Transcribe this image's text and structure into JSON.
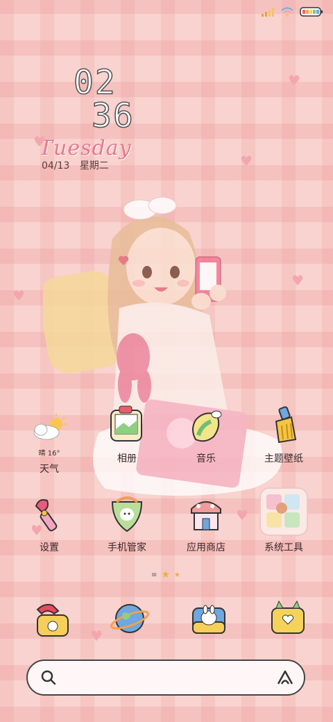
{
  "status": {
    "signal_icon": "signal-icon",
    "wifi_icon": "wifi-icon",
    "battery_icon": "battery-icon"
  },
  "clock": {
    "hours": "02",
    "minutes": "36",
    "day": "Tuesday",
    "date": "04/13",
    "weekday": "星期二"
  },
  "weather": {
    "temp": "晴 16°"
  },
  "apps_row1": [
    {
      "label": "天气",
      "icon": "weather-icon"
    },
    {
      "label": "相册",
      "icon": "gallery-icon"
    },
    {
      "label": "音乐",
      "icon": "music-icon"
    },
    {
      "label": "主题壁纸",
      "icon": "theme-brush-icon"
    }
  ],
  "apps_row2": [
    {
      "label": "设置",
      "icon": "settings-wand-icon"
    },
    {
      "label": "手机管家",
      "icon": "phone-manager-icon"
    },
    {
      "label": "应用商店",
      "icon": "app-store-icon"
    },
    {
      "label": "系统工具",
      "icon": "system-tools-folder-icon"
    }
  ],
  "dock": [
    {
      "icon": "phone-icon"
    },
    {
      "icon": "browser-planet-icon"
    },
    {
      "icon": "camera-icon"
    },
    {
      "icon": "messages-icon"
    }
  ],
  "colors": {
    "accent": "#e7788f",
    "background": "#f8d3cf"
  }
}
